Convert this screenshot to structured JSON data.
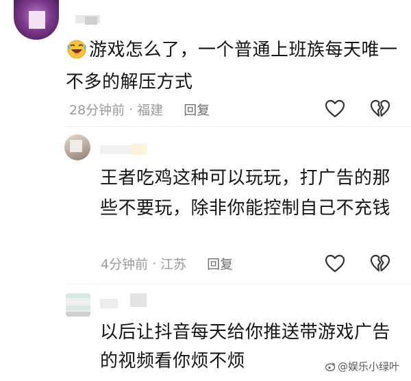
{
  "comments": [
    {
      "emoji": "laughing-crying-emoji",
      "text": "游戏怎么了，一个普通上班族每天唯一不多的解压方式",
      "time": "28分钟前",
      "separator": "·",
      "location": "福建",
      "reply_label": "回复"
    },
    {
      "text": "王者吃鸡这种可以玩玩，打广告的那些不要玩，除非你能控制自己不充钱",
      "time": "4分钟前",
      "separator": "·",
      "location": "江苏",
      "reply_label": "回复"
    },
    {
      "text": "以后让抖音每天给你推送带游戏广告的视频看你烦不烦"
    }
  ],
  "watermark": {
    "text": "@娱乐小绿叶",
    "icon": "weibo-like-icon"
  },
  "colors": {
    "body_text": "#141414",
    "meta_text": "#9a9a9a",
    "reply_text": "#6f6f6f",
    "icon_stroke": "#333333"
  }
}
